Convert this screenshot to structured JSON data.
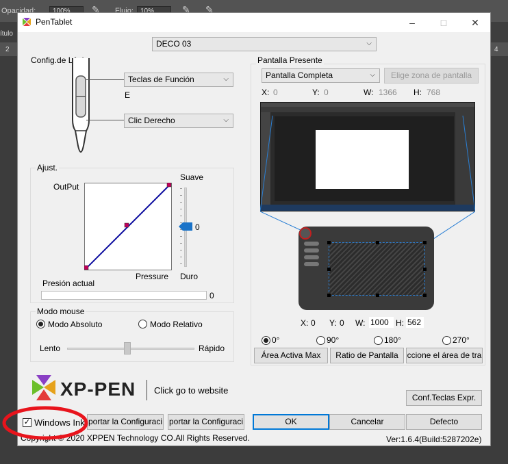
{
  "background_app": {
    "opacity_label": "Opacidad:",
    "opacity_value": "100%",
    "flow_label": "Flujo:",
    "flow_value": "10%",
    "left_tab": "ítulo",
    "ruler_mark": "2",
    "right_tab": "4"
  },
  "window": {
    "title": "PenTablet",
    "minimize": "–",
    "maximize": "□",
    "close": "✕"
  },
  "device_select": {
    "value": "DECO 03"
  },
  "pen": {
    "group_title": "Config.de Lápiz",
    "upper_button": "Teclas de Función",
    "upper_key": "E",
    "lower_button": "Clic Derecho"
  },
  "pressure": {
    "group_title": "Ajust.",
    "output_label": "OutPut",
    "pressure_label": "Pressure",
    "soft_label": "Suave",
    "hard_label": "Duro",
    "slider_value": "0",
    "current_label": "Presión actual",
    "current_value": "0",
    "slider_level": 0
  },
  "mouse_mode": {
    "group_title": "Modo mouse",
    "absolute": "Modo Absoluto",
    "relative": "Modo Relativo",
    "selected": "absolute",
    "slow_label": "Lento",
    "fast_label": "Rápido"
  },
  "screen": {
    "group_title": "Pantalla Presente",
    "display_select": "Pantalla Completa",
    "choose_zone": "Elige zona de pantalla",
    "x_label": "X:",
    "x_value": "0",
    "y_label": "Y:",
    "y_value": "0",
    "w_label": "W:",
    "w_value": "1366",
    "h_label": "H:",
    "h_value": "768"
  },
  "tablet_area": {
    "x_label": "X:",
    "x_value": "0",
    "y_label": "Y:",
    "y_value": "0",
    "w_label": "W:",
    "w_value": "1000",
    "h_label": "H:",
    "h_value": "562"
  },
  "rotation": {
    "options": [
      "0°",
      "90°",
      "180°",
      "270°"
    ],
    "selected": "0°"
  },
  "area_buttons": {
    "max": "Área Activa Max",
    "ratio": "Ratio de Pantalla",
    "select_area": "ccione el área de tra"
  },
  "brand": {
    "logo_text": "XP-PEN",
    "website": "Click go to website"
  },
  "bottom": {
    "expr_keys": "Conf.Teclas Expr.",
    "windows_ink": "Windows Ink",
    "windows_ink_checked": true,
    "export": "portar la Configuraci",
    "import": "portar la Configuraci",
    "ok": "OK",
    "cancel": "Cancelar",
    "default": "Defecto",
    "copyright": "Copyright © 2020 XPPEN Technology CO.All Rights Reserved.",
    "version": "Ver:1.6.4(Build:5287202e)"
  },
  "colors": {
    "annotation": "#e8141c",
    "accent": "#0078d7",
    "curve": "#1010a0",
    "curve_point": "#c0005a"
  }
}
